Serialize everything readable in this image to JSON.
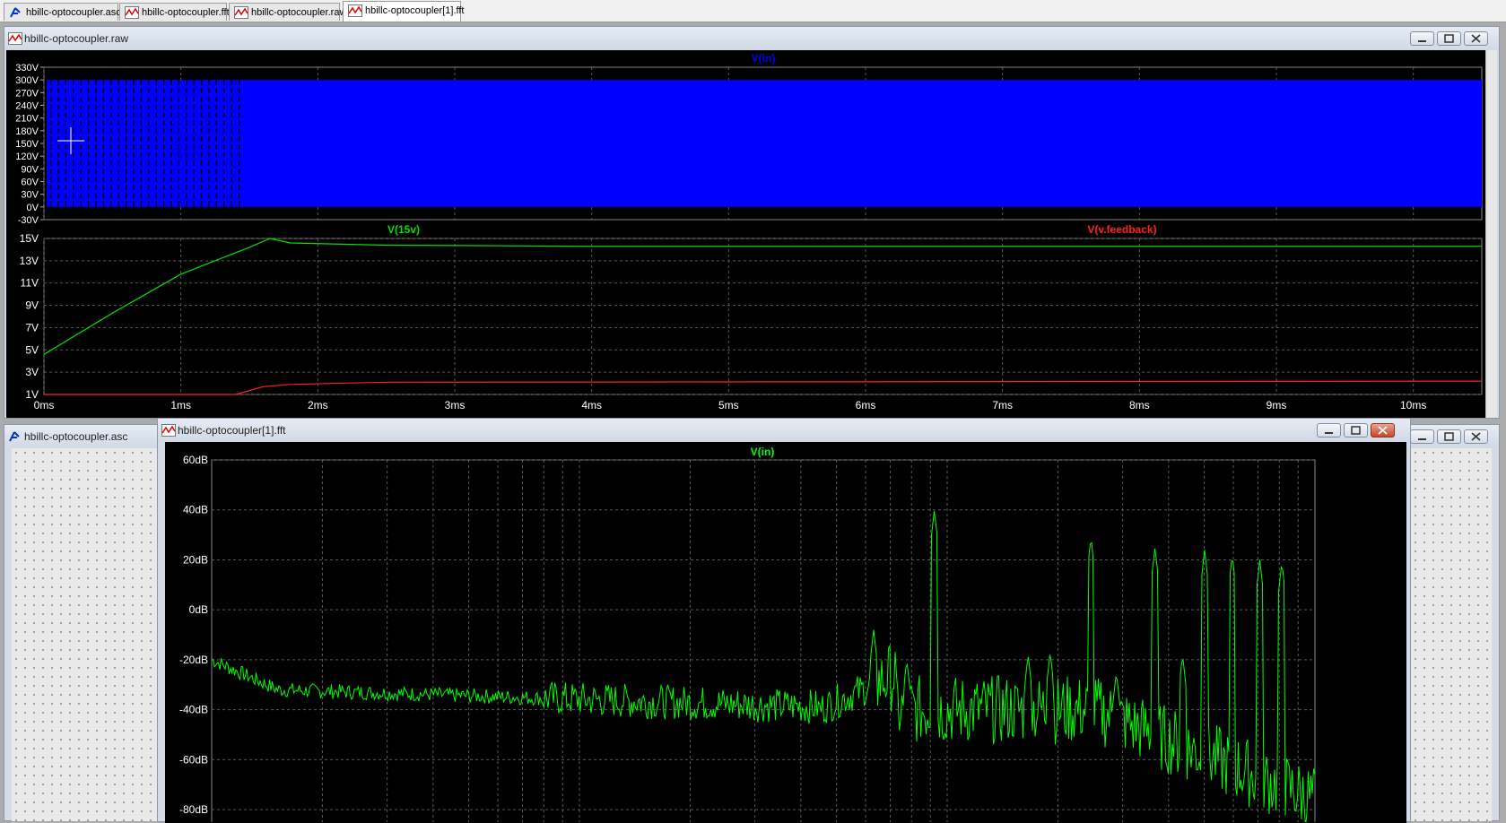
{
  "tabs": [
    {
      "label": "hbillc-optocoupler.asc",
      "icon": "schematic-icon"
    },
    {
      "label": "hbillc-optocoupler.fft",
      "icon": "waveform-icon"
    },
    {
      "label": "hbillc-optocoupler.raw",
      "icon": "waveform-icon"
    },
    {
      "label": "hbillc-optocoupler[1].fft",
      "icon": "waveform-icon"
    }
  ],
  "raw_window": {
    "title": "hbillc-optocoupler.raw",
    "top_pane": {
      "trace": "V(in)",
      "trace_color": "#0000ff",
      "y_ticks": [
        "330V",
        "300V",
        "270V",
        "240V",
        "210V",
        "180V",
        "150V",
        "120V",
        "90V",
        "60V",
        "30V",
        "0V",
        "-30V"
      ]
    },
    "bottom_pane": {
      "traces": [
        {
          "name": "V(15v)",
          "color": "#00e000"
        },
        {
          "name": "V(v.feedback)",
          "color": "#ff0000"
        }
      ],
      "y_ticks": [
        "15V",
        "13V",
        "11V",
        "9V",
        "7V",
        "5V",
        "3V",
        "1V"
      ],
      "x_ticks": [
        "0ms",
        "1ms",
        "2ms",
        "3ms",
        "4ms",
        "5ms",
        "6ms",
        "7ms",
        "8ms",
        "9ms",
        "10ms"
      ]
    }
  },
  "asc_window": {
    "title": "hbillc-optocoupler.asc"
  },
  "fft_window": {
    "title": "hbillc-optocoupler[1].fft",
    "trace": "V(in)",
    "trace_color": "#00ff00",
    "y_ticks": [
      "60dB",
      "40dB",
      "20dB",
      "0dB",
      "-20dB",
      "-40dB",
      "-60dB",
      "-80dB"
    ]
  },
  "chart_data": [
    {
      "type": "area",
      "title": "V(in)",
      "series": [
        {
          "name": "V(in)",
          "values": [
            0,
            300
          ]
        }
      ],
      "xlim": [
        0,
        10.5
      ],
      "ylim": [
        -30,
        330
      ],
      "ylabel": "V"
    },
    {
      "type": "line",
      "series": [
        {
          "name": "V(15v)",
          "x": [
            0,
            0.5,
            1,
            1.5,
            1.65,
            1.8,
            2.5,
            4,
            10.5
          ],
          "values": [
            4.6,
            8.3,
            11.8,
            14.2,
            15.0,
            14.6,
            14.4,
            14.3,
            14.3
          ]
        },
        {
          "name": "V(v.feedback)",
          "x": [
            0,
            1.4,
            1.6,
            1.8,
            2.5,
            10.5
          ],
          "values": [
            1.0,
            1.0,
            1.7,
            1.9,
            2.1,
            2.2
          ]
        }
      ],
      "xlim": [
        0,
        10.5
      ],
      "ylim": [
        1,
        15
      ]
    },
    {
      "type": "line",
      "title": "V(in)",
      "series": [
        {
          "name": "V(in)"
        }
      ],
      "ylim": [
        -85,
        60
      ]
    }
  ]
}
